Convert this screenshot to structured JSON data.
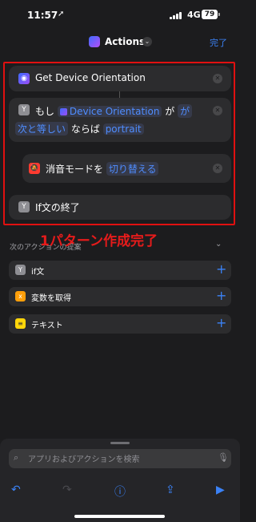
{
  "status_bar": {
    "time": "11:57",
    "location_glyph": "➚",
    "network": "4G",
    "battery": "79"
  },
  "nav": {
    "title": "Actions",
    "chevron": "⌄",
    "done": "完了"
  },
  "actions": {
    "get_orientation": {
      "label": "Get Device Orientation"
    },
    "if_block": {
      "line1_prefix": "もし",
      "variable": "Device Orientation",
      "particle": "が",
      "operator_part1": "が",
      "operator_part2": "次と等しい",
      "suffix": "ならば",
      "value": "portrait"
    },
    "silent_mode": {
      "label": "消音モードを",
      "value": "切り替える"
    },
    "end_if": {
      "label": "If文の終了"
    }
  },
  "annotation": {
    "text": "1パターン作成完了",
    "color": "#e61b1b"
  },
  "suggestions": {
    "header": "次のアクションの提案",
    "items": [
      {
        "label": "if文",
        "icon": "if-icon"
      },
      {
        "label": "変数を取得",
        "icon": "variable-icon"
      },
      {
        "label": "テキスト",
        "icon": "text-icon"
      }
    ]
  },
  "search": {
    "placeholder": "アプリおよびアクションを検索"
  },
  "colors": {
    "accent": "#3b82f6",
    "highlight_box": "#e01010"
  }
}
